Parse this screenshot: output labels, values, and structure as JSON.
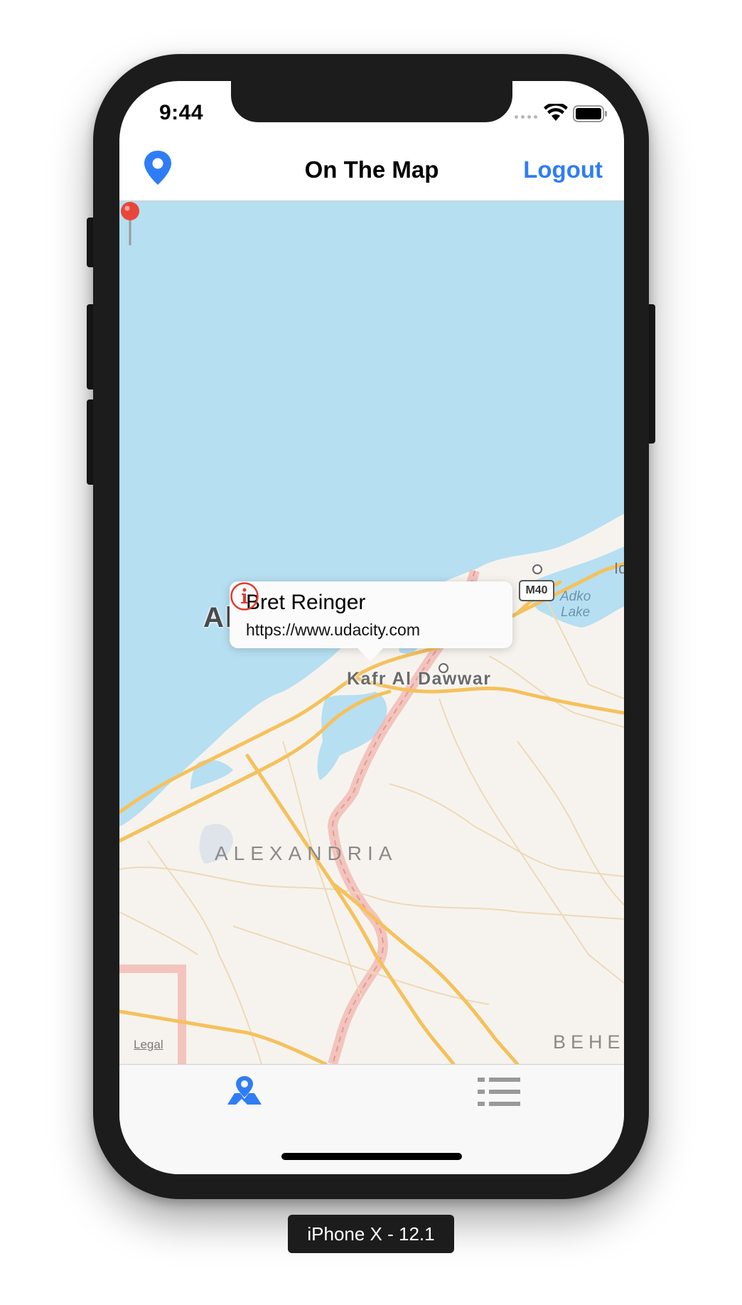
{
  "status_bar": {
    "time": "9:44"
  },
  "nav_bar": {
    "title": "On The Map",
    "logout_label": "Logout",
    "left_icon": "location-pin-icon"
  },
  "map": {
    "labels": {
      "city": "Alexandria",
      "town": "Kafr Al Dawwar",
      "region": "ALEXANDRIA",
      "region_right": "BEHE",
      "lake": [
        "Adko",
        "Lake"
      ],
      "road_shield": "M40",
      "edge_label": "Id",
      "legal": "Legal"
    },
    "water_color": "#b6dff1",
    "land_color": "#f6f3ee",
    "road_color": "#f5c15c",
    "border_color": "#f2b8b0"
  },
  "annotation": {
    "title": "Bret Reinger",
    "subtitle": "https://www.udacity.com",
    "pin_color": "#e8463a",
    "info_icon": "info-circle-icon",
    "info_color": "#e23a2e"
  },
  "tab_bar": {
    "items": [
      {
        "icon": "map-location-icon",
        "selected": true
      },
      {
        "icon": "list-icon",
        "selected": false
      }
    ],
    "accent": "#2f7df6"
  },
  "device_label": "iPhone X - 12.1"
}
